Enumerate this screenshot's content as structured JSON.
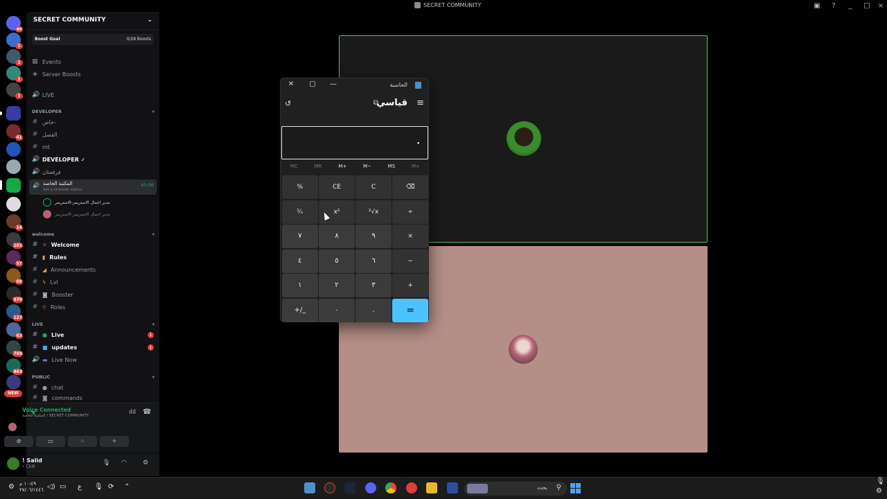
{
  "window": {
    "title": "SECRET COMMUNITY",
    "controls": [
      "_",
      "□",
      "×"
    ]
  },
  "servers": {
    "badges": [
      "40",
      "1",
      "2",
      "1",
      "1",
      "41",
      "14",
      "101",
      "57",
      "69",
      "570",
      "127",
      "63",
      "760",
      "863"
    ],
    "new_label": "NEW"
  },
  "guild": {
    "name": "SECRET COMMUNITY",
    "boost_label": "Boost Goal",
    "boost_count": "0/28 Boosts",
    "events": "Events",
    "server_boosts": "Server Boosts",
    "live": "LIVE"
  },
  "categories": {
    "developer": "DEVELOPER",
    "welcome": "welcome",
    "live": "LIVE",
    "public": "PUBLIC"
  },
  "channels": {
    "dev1": "خاص-",
    "dev2": "الفصل",
    "dev3": "mt",
    "dev4": "DEVELOPER ✓",
    "dev5": "فرقعتان",
    "active_name": "المكتبة الخاصة",
    "active_status": "Set a channel status",
    "active_time": "45:06",
    "voice_user1": "مدير اعمال الاستريمر-الاستريمر",
    "voice_user2": "مدير اعمال الاستريمر-الاستريمر",
    "welcome": "Welcome",
    "rules": "Rules",
    "announcements": "Announcements",
    "lvl": "Lvl",
    "booster": "Booster",
    "roles": "Roles",
    "live_ch": "Live",
    "updates": "updates",
    "live_now": "Live Now",
    "chat": "chat",
    "commands": "commands",
    "live_badge": "1",
    "updates_badge": "1"
  },
  "voice": {
    "title": "Voice Connected",
    "sub": "المكتبة الخاصة / SECRET COMMUNITY"
  },
  "user": {
    "name": "! Salid",
    "status": "• Chill"
  },
  "calculator": {
    "title": "الحاسبة",
    "mode": "قياسي",
    "display": "٠",
    "memory": [
      "MC",
      "MR",
      "M+",
      "M−",
      "MS",
      "M∨"
    ],
    "memory_dim": [
      true,
      true,
      false,
      false,
      false,
      true
    ],
    "keys": [
      "%",
      "CE",
      "C",
      "⌫",
      "¹⁄ₓ",
      "x²",
      "²√x",
      "÷",
      "٧",
      "٨",
      "٩",
      "×",
      "٤",
      "٥",
      "٦",
      "−",
      "١",
      "٢",
      "٣",
      "+",
      "+/_",
      "٠",
      ".",
      "="
    ],
    "accent": "#4cc2ff"
  },
  "taskbar": {
    "time": "١٠:٤٩ م",
    "date": "٢٧/٠٦/١٤٤٦",
    "lang": "ع",
    "search": "بحث"
  },
  "colors": {
    "tile_border": "#57c95a",
    "voice_green": "#23a55a",
    "badge_red": "#e23c3c",
    "tile2_bg": "#b58e88"
  }
}
